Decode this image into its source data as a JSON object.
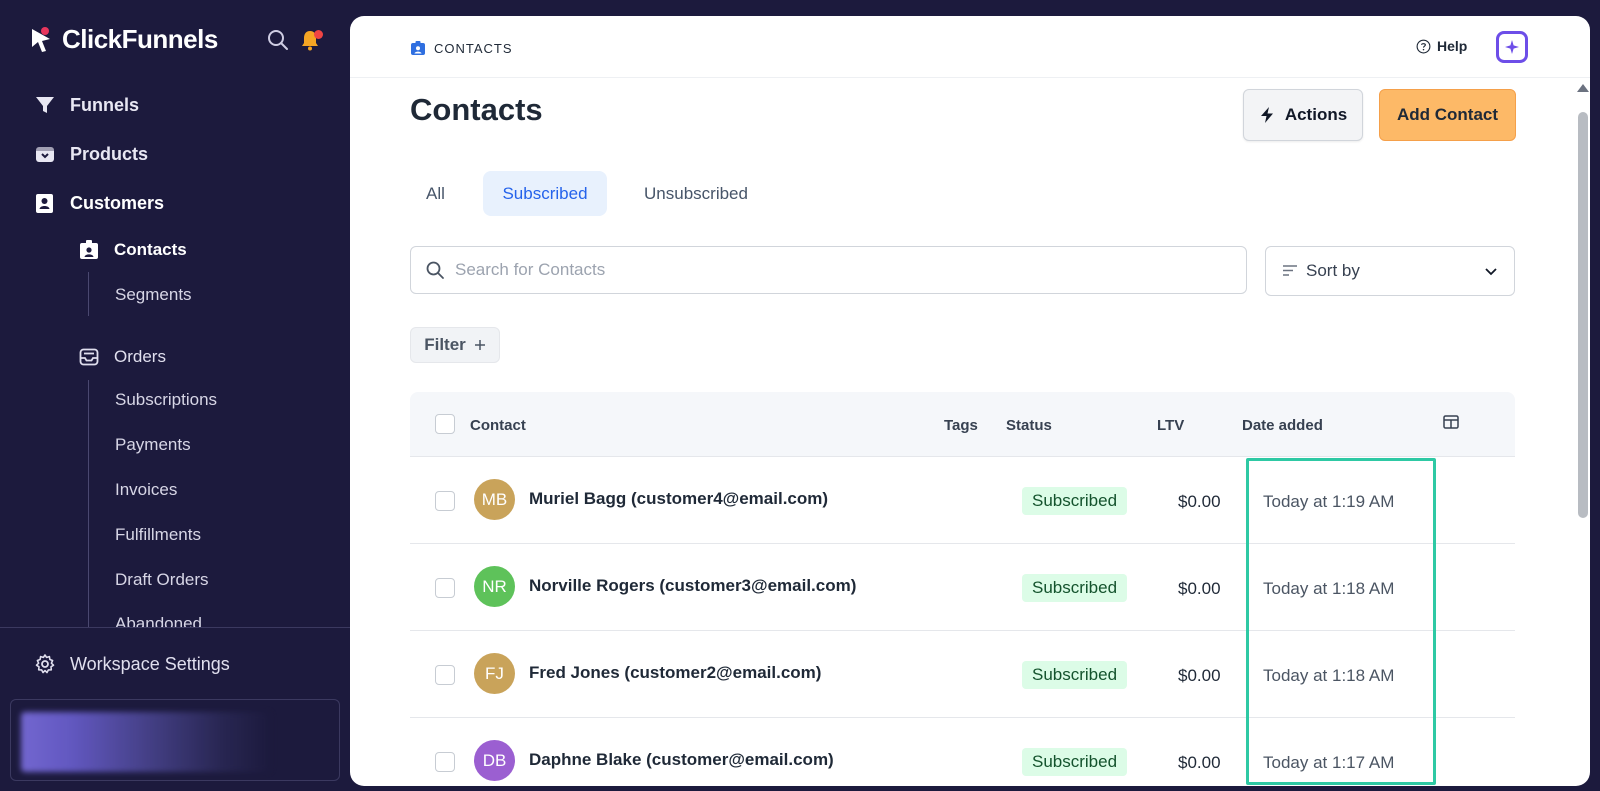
{
  "brand": {
    "name": "ClickFunnels"
  },
  "sidebar": {
    "nav": [
      {
        "label": "Funnels",
        "icon": "funnel-icon"
      },
      {
        "label": "Products",
        "icon": "box-icon"
      },
      {
        "label": "Customers",
        "icon": "contact-book-icon"
      }
    ],
    "customers_sub": {
      "active": "Contacts",
      "segments": "Segments",
      "orders": "Orders",
      "order_items": [
        "Subscriptions",
        "Payments",
        "Invoices",
        "Fulfillments",
        "Draft Orders",
        "Abandoned"
      ]
    },
    "workspace_settings": "Workspace Settings"
  },
  "topbar": {
    "breadcrumb": "CONTACTS",
    "help": "Help"
  },
  "page": {
    "title": "Contacts",
    "actions_label": "Actions",
    "add_label": "Add Contact"
  },
  "tabs": [
    "All",
    "Subscribed",
    "Unsubscribed"
  ],
  "active_tab": "Subscribed",
  "search": {
    "placeholder": "Search for Contacts"
  },
  "sort": {
    "label": "Sort by"
  },
  "filter": {
    "label": "Filter"
  },
  "table": {
    "columns": [
      "Contact",
      "Tags",
      "Status",
      "LTV",
      "Date added"
    ],
    "rows": [
      {
        "initials": "MB",
        "avatar_color": "#c9a35a",
        "name": "Muriel Bagg (customer4@email.com)",
        "status": "Subscribed",
        "ltv": "$0.00",
        "date": "Today at 1:19 AM"
      },
      {
        "initials": "NR",
        "avatar_color": "#5ec25a",
        "name": "Norville Rogers (customer3@email.com)",
        "status": "Subscribed",
        "ltv": "$0.00",
        "date": "Today at 1:18 AM"
      },
      {
        "initials": "FJ",
        "avatar_color": "#c9a35a",
        "name": "Fred Jones (customer2@email.com)",
        "status": "Subscribed",
        "ltv": "$0.00",
        "date": "Today at 1:18 AM"
      },
      {
        "initials": "DB",
        "avatar_color": "#9b5fd1",
        "name": "Daphne Blake (customer@email.com)",
        "status": "Subscribed",
        "ltv": "$0.00",
        "date": "Today at 1:17 AM"
      }
    ]
  },
  "colors": {
    "sidebar_bg": "#1c1a3d",
    "accent_orange": "#fdb967",
    "accent_blue": "#2563eb",
    "highlight": "#2ec9a4"
  }
}
